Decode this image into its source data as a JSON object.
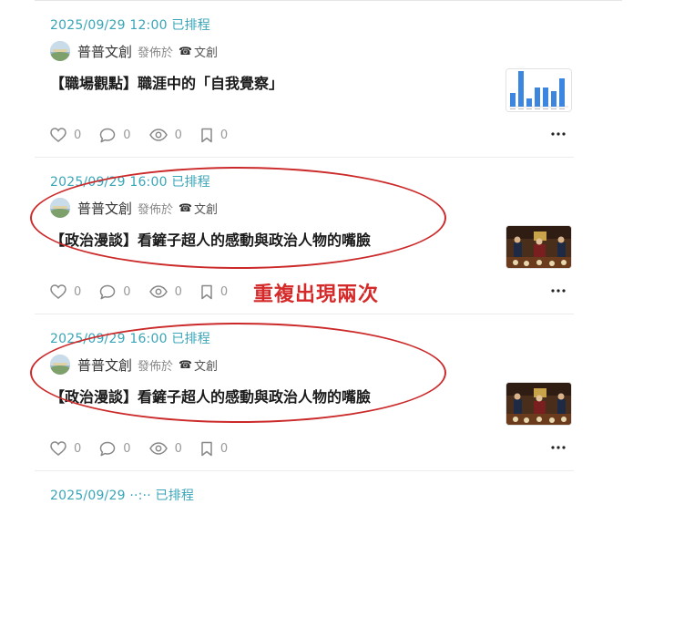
{
  "posts": [
    {
      "schedule": "2025/09/29 12:00 已排程",
      "author": "普普文創",
      "published_label": "發佈於",
      "category_icon": "☎",
      "category": "文創",
      "title": "【職場觀點】職涯中的「自我覺察」",
      "thumbnail": "bar-chart-thumbnail",
      "stats": {
        "likes": "0",
        "comments": "0",
        "views": "0",
        "bookmarks": "0"
      }
    },
    {
      "schedule": "2025/09/29 16:00 已排程",
      "author": "普普文創",
      "published_label": "發佈於",
      "category_icon": "☎",
      "category": "文創",
      "title": "【政治漫談】看鏟子超人的感動與政治人物的嘴臉",
      "thumbnail": "painting-thumbnail",
      "stats": {
        "likes": "0",
        "comments": "0",
        "views": "0",
        "bookmarks": "0"
      }
    },
    {
      "schedule": "2025/09/29 16:00 已排程",
      "author": "普普文創",
      "published_label": "發佈於",
      "category_icon": "☎",
      "category": "文創",
      "title": "【政治漫談】看鏟子超人的感動與政治人物的嘴臉",
      "thumbnail": "painting-thumbnail",
      "stats": {
        "likes": "0",
        "comments": "0",
        "views": "0",
        "bookmarks": "0"
      }
    },
    {
      "schedule": "2025/09/29 ··:·· 已排程"
    }
  ],
  "annotation": {
    "text": "重複出現兩次",
    "color": "#d42a2a"
  },
  "colors": {
    "schedule_text": "#3aa5b8",
    "annotation_ring": "#cc2a2a"
  }
}
